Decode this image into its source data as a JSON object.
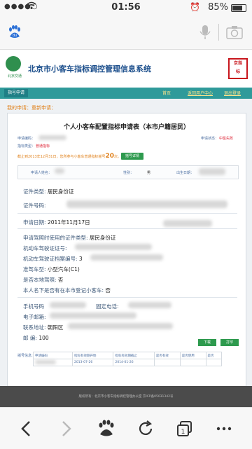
{
  "status_bar": {
    "time": "01:56",
    "battery_text": "85%",
    "battery_level": 0.85
  },
  "url_bar": {
    "mic_icon": "microphone-icon",
    "camera_icon": "camera-icon",
    "baidu_icon": "baidu-paw-icon"
  },
  "header": {
    "logo_text": "北京交通",
    "title": "北京市小客车指标调控管理信息系统",
    "seal_text": [
      "京指",
      "标"
    ]
  },
  "nav": {
    "tab_label": "指号申请",
    "links": [
      "首页",
      "返回用户中心",
      "退出登录"
    ]
  },
  "breadcrumb": "我的申请：重新申请：",
  "form": {
    "title": "个人小客车配置指标申请表（本市户籍居民）",
    "apply_code_label": "申请编码：",
    "indicator_type_label": "指标类型：",
    "indicator_type_value": "普通指标",
    "status_label": "申请状态：",
    "status_value": "中签失败",
    "deadline_note_prefix": "截止到2013年12月31日，您所参与小客车普通指标摇号",
    "deadline_count": "20",
    "deadline_note_suffix": "次。",
    "detail_button": "摇号详情",
    "applicant_name_label": "申请人姓名：",
    "gender_label": "性别：",
    "gender_value": "男",
    "birth_label": "出生日期：",
    "id_type_label": "证件类型:",
    "id_type_value": "居民身份证",
    "id_number_label": "证件号码:",
    "apply_date_label": "申请日期:",
    "apply_date_value": "2011年11月17日",
    "license_id_type_label": "申请驾照时使用的证件类型:",
    "license_id_type_value": "居民身份证",
    "license_number_label": "机动车驾驶证证号:",
    "license_file_label": "机动车驾驶证档案编号:",
    "license_file_value": "3",
    "vehicle_class_label": "准驾车型:",
    "vehicle_class_value": "小型汽车(C1)",
    "local_license_label": "是否本地驾照:",
    "local_license_value": "否",
    "registered_car_label": "本人名下是否有在本市登记小客车:",
    "registered_car_value": "否",
    "phone_label": "手机号码",
    "landline_label": "固定电话:",
    "email_label": "电子邮箱:",
    "address_label": "联系地址:",
    "address_value": "朝阳区",
    "postcode_label": "邮    编:",
    "postcode_value": "100",
    "download_button": "下载",
    "print_button": "打印",
    "history_label": "摇号信息:",
    "history_header": [
      "申请编码",
      "指标有效期开始",
      "指标有效期截止",
      "是否有效",
      "是否使用",
      "是否"
    ],
    "history_row": [
      "",
      "2013-07-26",
      "2014-01-26",
      "",
      "",
      ""
    ]
  },
  "footer": {
    "text": "版权所有：北京市小客车指标调控管理办公室 京ICP备05031342号"
  },
  "colors": {
    "teal": "#2f9a9a",
    "green": "#2e9a4e",
    "orange": "#e0801a",
    "navy": "#1c4f8c"
  }
}
